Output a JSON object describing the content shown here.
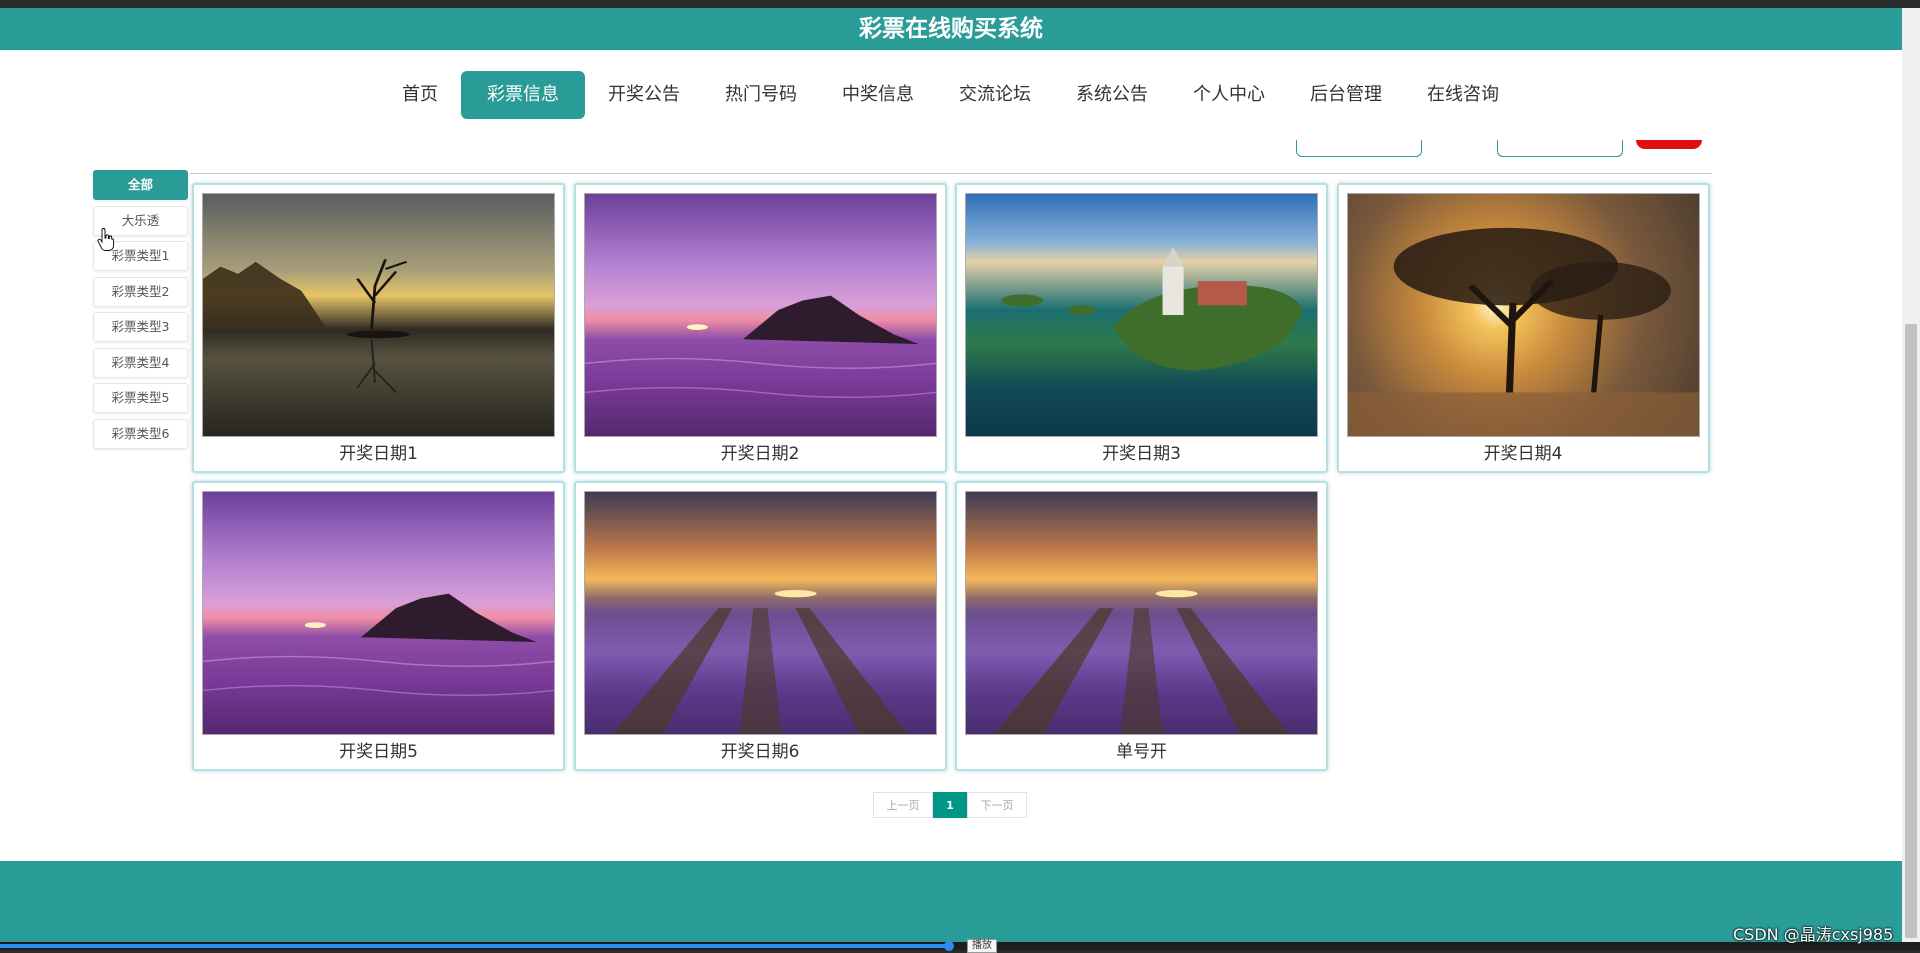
{
  "site": {
    "title": "彩票在线购买系统"
  },
  "nav": {
    "items": [
      {
        "label": "首页"
      },
      {
        "label": "彩票信息",
        "active": true
      },
      {
        "label": "开奖公告"
      },
      {
        "label": "热门号码"
      },
      {
        "label": "中奖信息"
      },
      {
        "label": "交流论坛"
      },
      {
        "label": "系统公告"
      },
      {
        "label": "个人中心"
      },
      {
        "label": "后台管理"
      },
      {
        "label": "在线咨询"
      }
    ]
  },
  "categories": {
    "items": [
      {
        "label": "全部",
        "active": true
      },
      {
        "label": "大乐透"
      },
      {
        "label": "彩票类型1"
      },
      {
        "label": "彩票类型2"
      },
      {
        "label": "彩票类型3"
      },
      {
        "label": "彩票类型4"
      },
      {
        "label": "彩票类型5"
      },
      {
        "label": "彩票类型6"
      }
    ]
  },
  "cards": [
    {
      "caption": "开奖日期1",
      "image": "lake-tree-sunset"
    },
    {
      "caption": "开奖日期2",
      "image": "purple-sea-island"
    },
    {
      "caption": "开奖日期3",
      "image": "island-town-lake"
    },
    {
      "caption": "开奖日期4",
      "image": "tree-sunrise"
    },
    {
      "caption": "开奖日期5",
      "image": "purple-sea-island"
    },
    {
      "caption": "开奖日期6",
      "image": "lavender-field"
    },
    {
      "caption": "单号开",
      "image": "lavender-field"
    }
  ],
  "pagination": {
    "prev": "上一页",
    "current": "1",
    "next": "下一页"
  },
  "player": {
    "tooltip": "播放"
  },
  "watermark": "CSDN @晶涛cxsj985",
  "colors": {
    "primary": "#2a9c98",
    "pager_active": "#009688",
    "accent_red": "#e01010"
  }
}
